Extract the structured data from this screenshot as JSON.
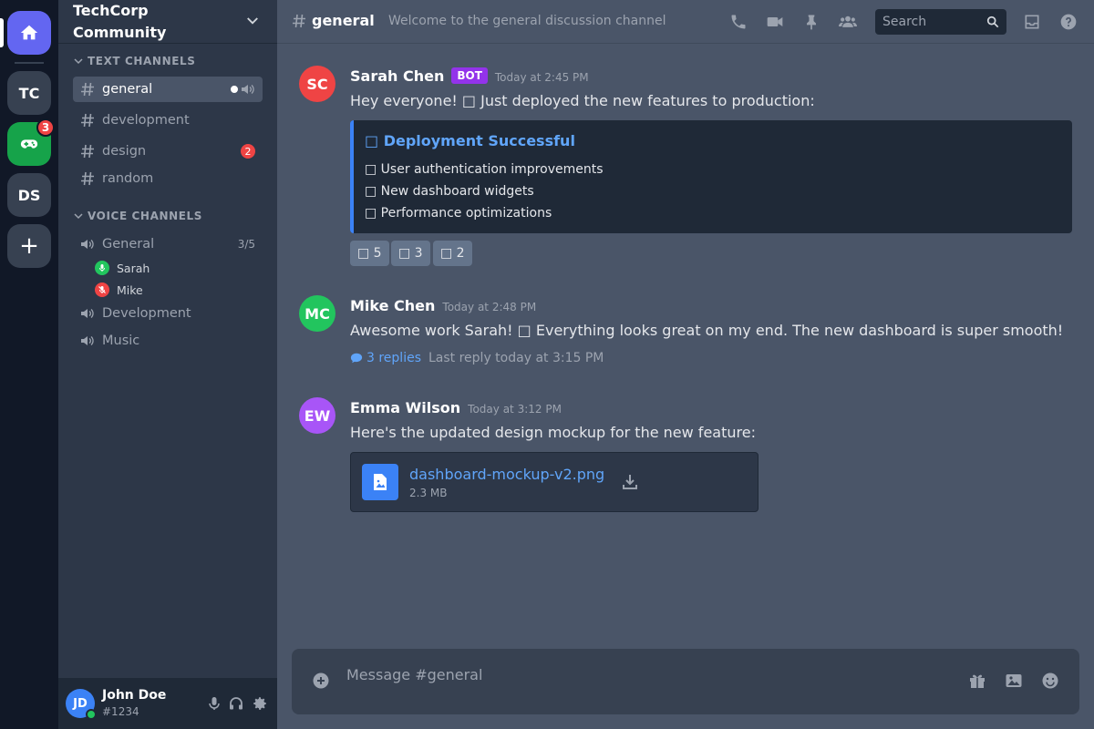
{
  "servers": {
    "home_icon": "home-icon",
    "items": [
      {
        "label": "TC"
      },
      {
        "label": "DS"
      }
    ],
    "game_icon": "gamepad-icon",
    "game_badge": "3",
    "add_label": "+"
  },
  "guild": {
    "name_line1": "TechCorp",
    "name_line2": "Community"
  },
  "text_category": "TEXT CHANNELS",
  "text_channels": [
    {
      "name": "general"
    },
    {
      "name": "development"
    },
    {
      "name": "design",
      "badge": "2"
    },
    {
      "name": "random"
    }
  ],
  "voice_category": "VOICE CHANNELS",
  "voice_channels": [
    {
      "name": "General",
      "count": "3/5"
    },
    {
      "name": "Development"
    },
    {
      "name": "Music"
    }
  ],
  "voice_users": [
    {
      "name": "Sarah",
      "status": "mic-on",
      "color": "#22c55e"
    },
    {
      "name": "Mike",
      "status": "mic-muted",
      "color": "#ef4444"
    }
  ],
  "user": {
    "initials": "JD",
    "name": "John Doe",
    "tag": "#1234"
  },
  "header": {
    "channel": "general",
    "topic": "Welcome to the general discussion channel",
    "search_placeholder": "Search"
  },
  "messages": [
    {
      "initials": "SC",
      "author": "Sarah Chen",
      "badge": "BOT",
      "time": "Today at 2:45 PM",
      "text": "Hey everyone! □ Just deployed the new features to production:",
      "avatar_color": "#ef4444",
      "embed": {
        "title": "□ Deployment Successful",
        "lines": [
          "□ User authentication improvements",
          "□ New dashboard widgets",
          "□ Performance optimizations"
        ]
      },
      "reactions": [
        {
          "label": "□ 5"
        },
        {
          "label": "□ 3"
        },
        {
          "label": "□ 2"
        }
      ]
    },
    {
      "initials": "MC",
      "author": "Mike Chen",
      "time": "Today at 2:48 PM",
      "text": "Awesome work Sarah! □ Everything looks great on my end. The new dashboard is super smooth!",
      "avatar_color": "#22c55e",
      "thread": {
        "replies": "3 replies",
        "last": "Last reply today at 3:15 PM"
      }
    },
    {
      "initials": "EW",
      "author": "Emma Wilson",
      "time": "Today at 3:12 PM",
      "text": "Here's the updated design mockup for the new feature:",
      "avatar_color": "#a855f7",
      "file": {
        "name": "dashboard-mockup-v2.png",
        "size": "2.3 MB"
      }
    }
  ],
  "composer": {
    "placeholder": "Message #general"
  },
  "colors": {
    "accent": "#6366f1",
    "link": "#60a5fa",
    "danger": "#ef4444",
    "success": "#22c55e"
  }
}
